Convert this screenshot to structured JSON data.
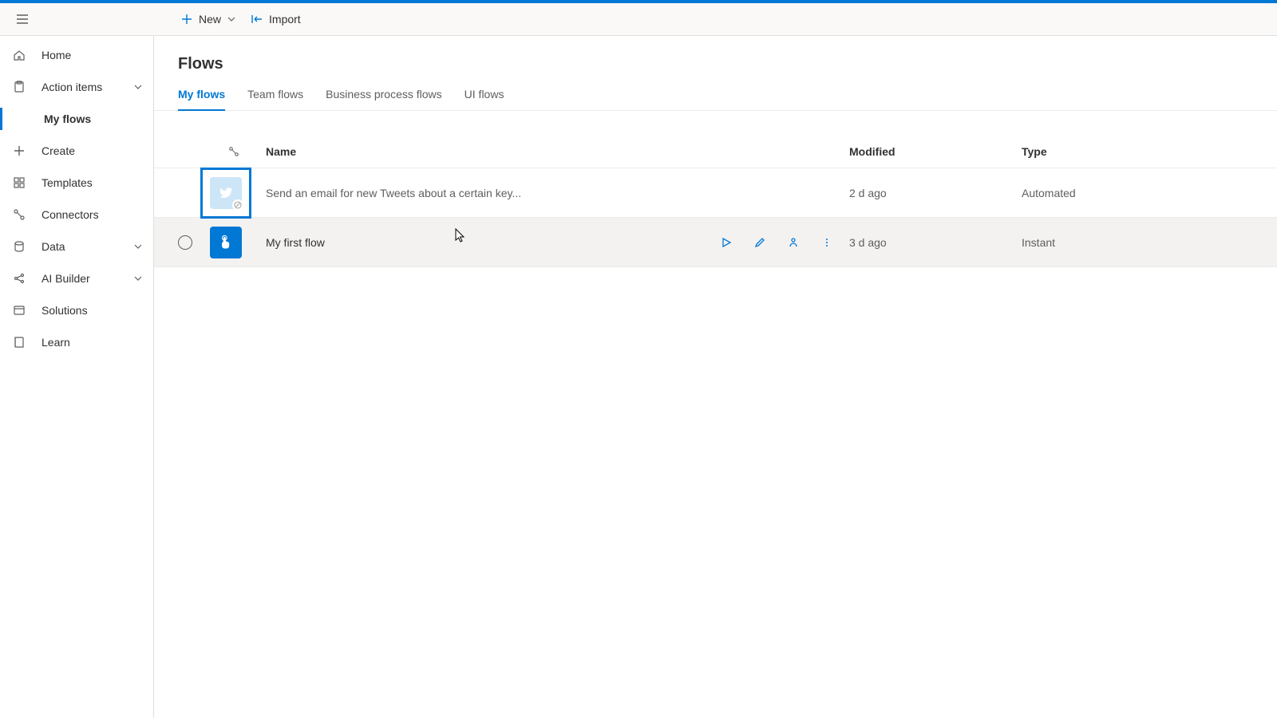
{
  "commandBar": {
    "new": "New",
    "import": "Import"
  },
  "sidebar": {
    "items": [
      {
        "label": "Home"
      },
      {
        "label": "Action items"
      },
      {
        "label": "My flows"
      },
      {
        "label": "Create"
      },
      {
        "label": "Templates"
      },
      {
        "label": "Connectors"
      },
      {
        "label": "Data"
      },
      {
        "label": "AI Builder"
      },
      {
        "label": "Solutions"
      },
      {
        "label": "Learn"
      }
    ]
  },
  "page": {
    "title": "Flows"
  },
  "tabs": [
    {
      "label": "My flows"
    },
    {
      "label": "Team flows"
    },
    {
      "label": "Business process flows"
    },
    {
      "label": "UI flows"
    }
  ],
  "columns": {
    "name": "Name",
    "modified": "Modified",
    "type": "Type"
  },
  "rows": [
    {
      "name": "Send an email for new Tweets about a certain key...",
      "modified": "2 d ago",
      "type": "Automated",
      "iconKind": "twitter",
      "framed": true
    },
    {
      "name": "My first flow",
      "modified": "3 d ago",
      "type": "Instant",
      "iconKind": "instant",
      "hover": true
    }
  ]
}
